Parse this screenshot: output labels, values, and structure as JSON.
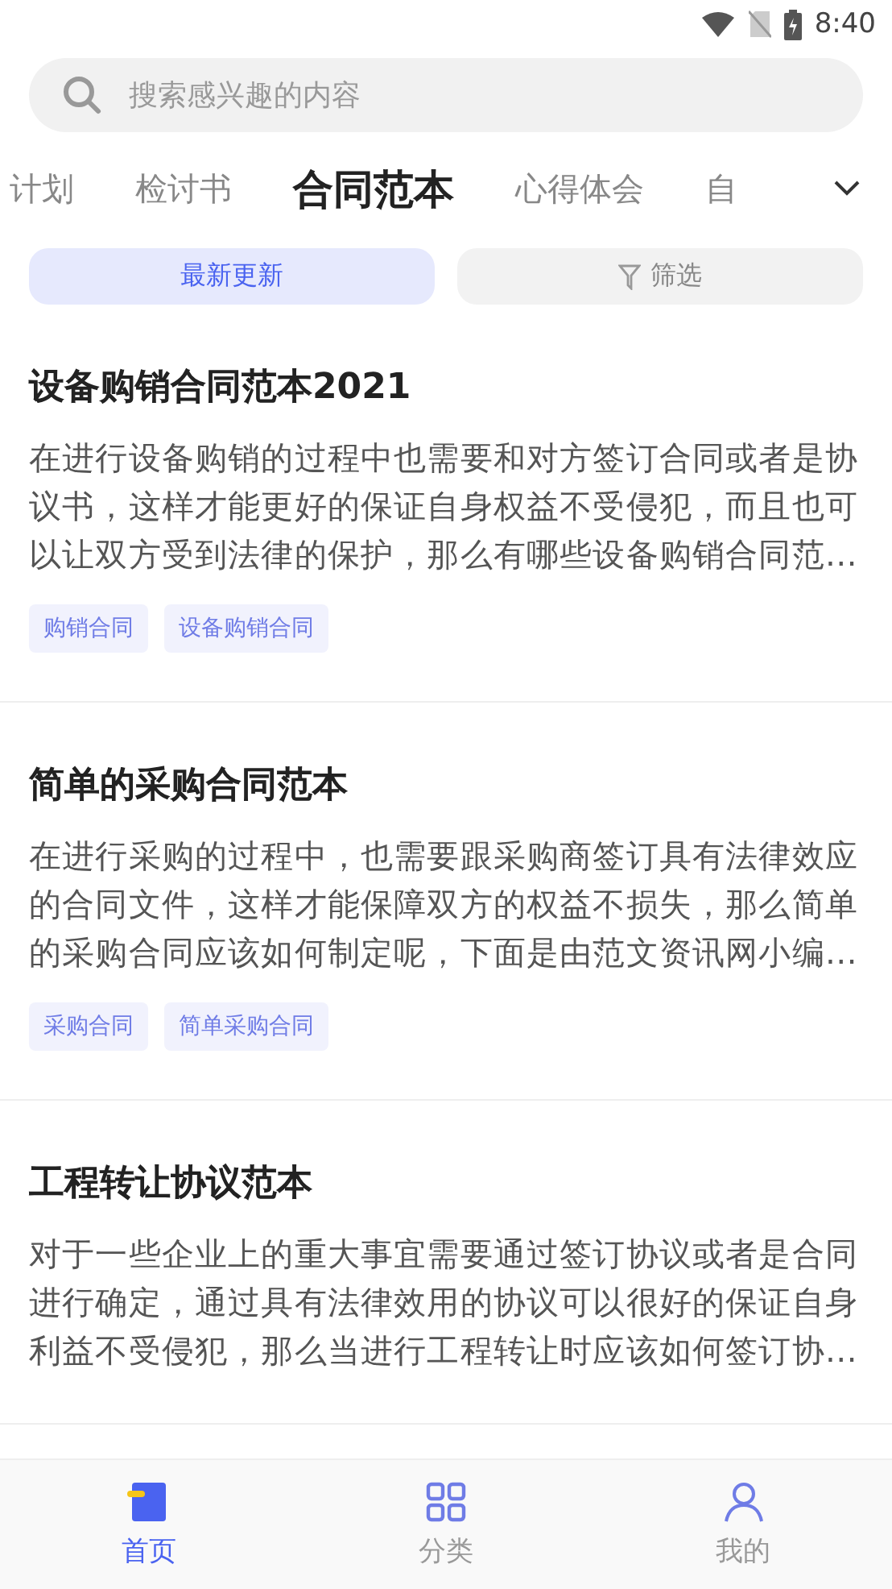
{
  "status_bar": {
    "time": "8:40"
  },
  "search": {
    "placeholder": "搜索感兴趣的内容"
  },
  "tabs": [
    {
      "label": "计划",
      "selected": false
    },
    {
      "label": "检讨书",
      "selected": false
    },
    {
      "label": "合同范本",
      "selected": true
    },
    {
      "label": "心得体会",
      "selected": false
    },
    {
      "label": "自",
      "selected": false
    }
  ],
  "sort_buttons": [
    {
      "label": "最新更新",
      "selected": true,
      "kind": "plain"
    },
    {
      "label": "筛选",
      "selected": false,
      "kind": "filter"
    }
  ],
  "articles": [
    {
      "title": "设备购销合同范本2021",
      "summary": "在进行设备购销的过程中也需要和对方签订合同或者是协议书，这样才能更好的保证自身权益不受侵犯，而且也可以让双方受到法律的保护，那么有哪些设备购销合同范…",
      "tags": [
        "购销合同",
        "设备购销合同"
      ]
    },
    {
      "title": "简单的采购合同范本",
      "summary": "在进行采购的过程中，也需要跟采购商签订具有法律效应的合同文件，这样才能保障双方的权益不损失，那么简单的采购合同应该如何制定呢，下面是由范文资讯网小编…",
      "tags": [
        "采购合同",
        "简单采购合同"
      ]
    },
    {
      "title": "工程转让协议范本",
      "summary": "对于一些企业上的重大事宜需要通过签订协议或者是合同进行确定，通过具有法律效用的协议可以很好的保证自身利益不受侵犯，那么当进行工程转让时应该如何签订协…"
    }
  ],
  "bottom_nav": [
    {
      "label": "首页",
      "kind": "home",
      "selected": true
    },
    {
      "label": "分类",
      "kind": "grid",
      "selected": false
    },
    {
      "label": "我的",
      "kind": "person",
      "selected": false
    }
  ]
}
